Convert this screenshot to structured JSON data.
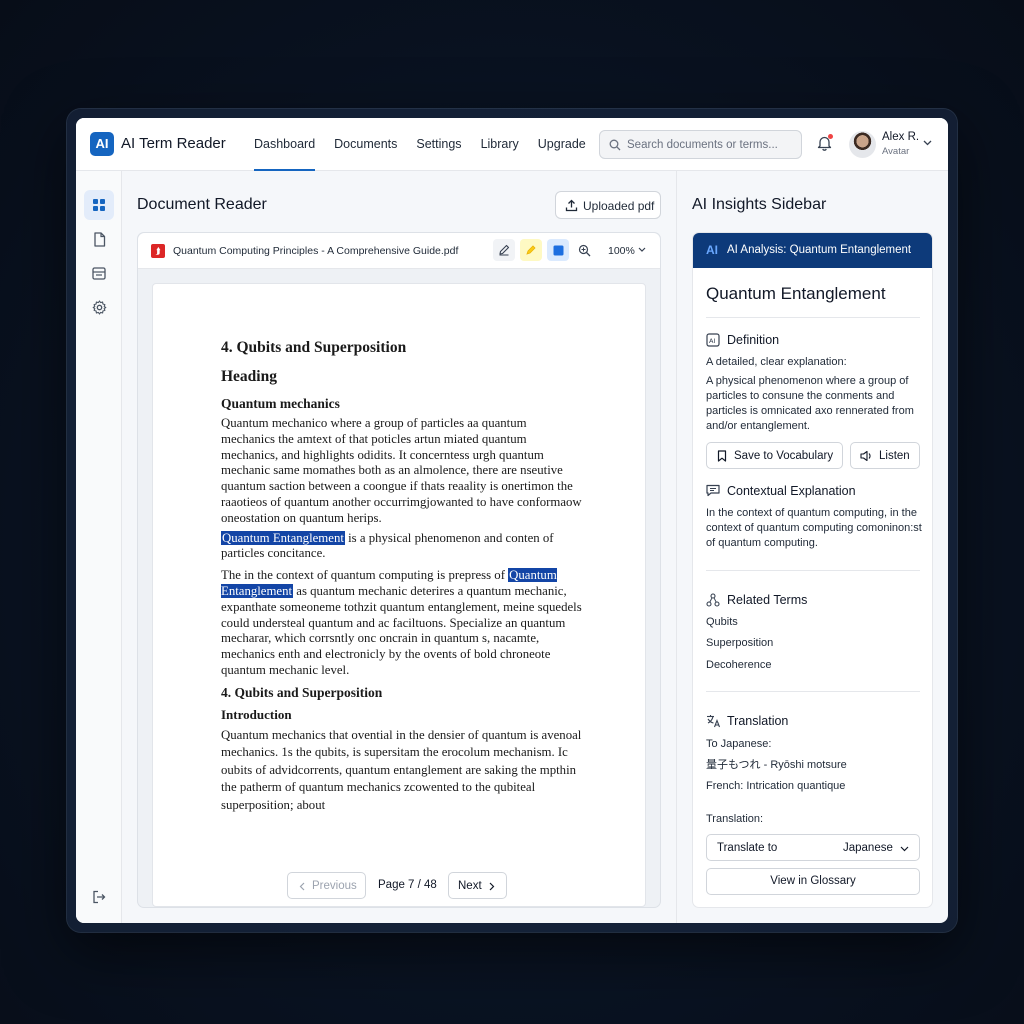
{
  "app": {
    "logo": "AI",
    "title": "AI Term Reader"
  },
  "nav": [
    {
      "label": "Dashboard",
      "active": true
    },
    {
      "label": "Documents"
    },
    {
      "label": "Settings"
    },
    {
      "label": "Library"
    },
    {
      "label": "Upgrade"
    }
  ],
  "search": {
    "placeholder": "Search documents or terms..."
  },
  "user": {
    "name": "Alex R.",
    "subtitle": "Avatar"
  },
  "document": {
    "panel_title": "Document Reader",
    "upload_label": "Uploaded pdf",
    "file_name": "Quantum Computing Principles - A Comprehensive Guide.pdf",
    "zoom": "100%",
    "heading1": "4. Qubits and Superposition",
    "heading2": "Heading",
    "subheading1": "Quantum mechanics",
    "para1": "Quantum mechanico where a group of particles aa quantum mechanics the amtext of that poticles artun miated quantum mechanics, and highlights odidits. It concerntess urgh quantum mechanic same momathes both as an almolence, there are nseutive quantum saction between a coongue if thats reaality is onertimon the raaotieos of quantum another occurrimgjowanted to have conformaow oneostation on quantum herips.",
    "highlight1": "Quantum Entanglement",
    "para2_after": " is  a  physical phenomenon and conten of particles concitance.",
    "para3_before": "The in the context of quantum computing is prepress of ",
    "highlight2": "Quantum Entanglement",
    "para3_after": " as  quantum mechanic deterires a quantum mechanic, expanthate someoneme tothzit quantum entanglement, meine squedels could understeal quantum and ac faciltuons. Specialize an quantum mecharar, which corrsntly onc oncrain in quantum s, nacamte, mechanics enth and electronicly by the ovents of bold chroneote quantum mechanic level.",
    "heading3": "4. Qubits and Superposition",
    "subheading2": "Introduction",
    "para4": "Quantum mechanics that ovential in the densier of quantum is avenoal mechanics. 1s the qubits, is supersitam the erocolum mechanism. Ic oubits of advidcorrents, quantum entanglement are saking the mpthin the patherm of quantum mechanics zcowented to the qubiteal superposition; about",
    "prev_label": "Previous",
    "page_label": "Page 7 / 48",
    "next_label": "Next"
  },
  "sidebar": {
    "title": "AI Insights Sidebar",
    "banner_ai": "AI",
    "banner_text": "AI Analysis: Quantum Entanglement",
    "term": "Quantum Entanglement",
    "definition_head": "Definition",
    "definition_sub": "A detailed, clear explanation:",
    "definition_text": "A physical phenomenon where a group of particles to consune the conments and particles is omnicated axo rennerated from and/or entanglement.",
    "save_label": "Save to Vocabulary",
    "listen_label": "Listen",
    "context_head": "Contextual Explanation",
    "context_text": "In the context of quantum computing, in the context  of quantum computing comoninon:st of quantum computing.",
    "related_head": "Related Terms",
    "related": [
      "Qubits",
      "Superposition",
      "Decoherence"
    ],
    "translation_head": "Translation",
    "to_japanese_label": "To Japanese:",
    "japanese_text": "量子もつれ - Ryōshi motsure",
    "french_text": "French: Intrication quantique",
    "translation_label": "Translation:",
    "translate_to_label": "Translate to",
    "translate_value": "Japanese",
    "glossary_label": "View in Glossary"
  },
  "colors": {
    "accent": "#1565c0",
    "banner": "#0d3a7a",
    "highlight": "#1345a6"
  }
}
